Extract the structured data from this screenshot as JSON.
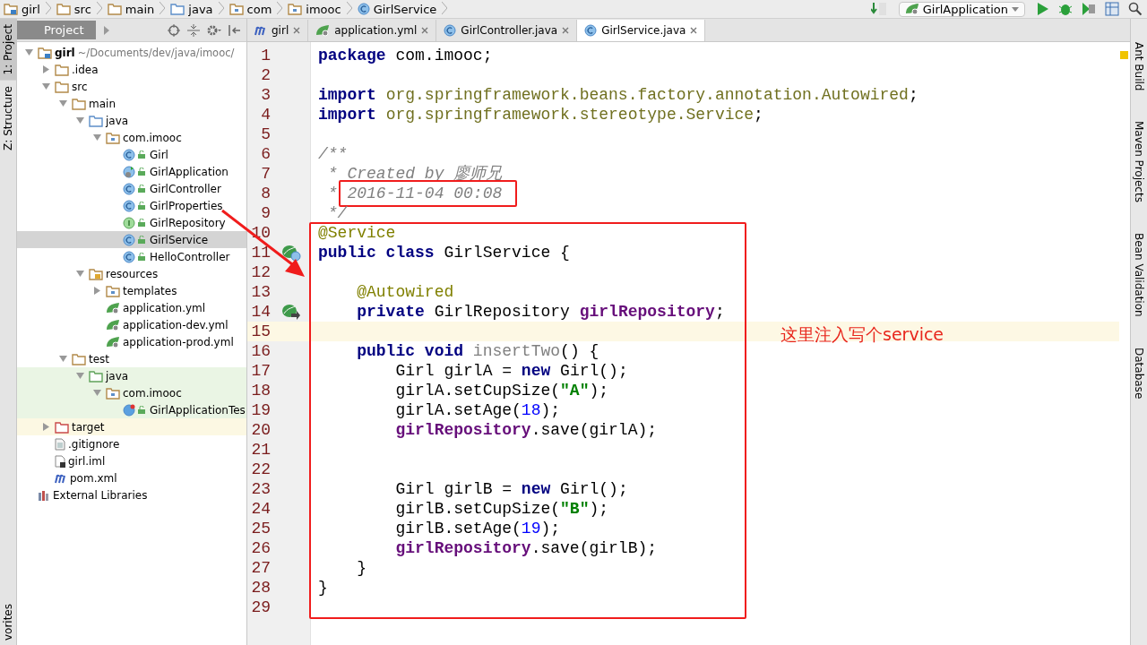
{
  "breadcrumbs": [
    {
      "label": "girl",
      "kind": "module"
    },
    {
      "label": "src",
      "kind": "folder"
    },
    {
      "label": "main",
      "kind": "folder"
    },
    {
      "label": "java",
      "kind": "source"
    },
    {
      "label": "com",
      "kind": "package"
    },
    {
      "label": "imooc",
      "kind": "package"
    },
    {
      "label": "GirlService",
      "kind": "class"
    }
  ],
  "run_config": {
    "label": "GirlApplication"
  },
  "side_tools_left": [
    {
      "label": "1: Project",
      "selected": true
    },
    {
      "label": "Z: Structure",
      "selected": false
    },
    {
      "label": "vorites",
      "selected": false
    }
  ],
  "side_tools_right": [
    {
      "label": "Ant Build"
    },
    {
      "label": "Maven Projects"
    },
    {
      "label": "Bean Validation"
    },
    {
      "label": "Database"
    }
  ],
  "project_panel": {
    "title": "Project"
  },
  "tabs": [
    {
      "label": "girl",
      "kind": "maven",
      "selected": false
    },
    {
      "label": "application.yml",
      "kind": "yml",
      "selected": false
    },
    {
      "label": "GirlController.java",
      "kind": "class",
      "selected": false
    },
    {
      "label": "GirlService.java",
      "kind": "class",
      "selected": true
    }
  ],
  "tree": [
    {
      "label": "girl",
      "kind": "module",
      "hint": "~/Documents/dev/java/imooc/",
      "expanded": true,
      "selected": false,
      "children": [
        {
          "label": ".idea",
          "kind": "folder",
          "expanded": false,
          "selected": false
        },
        {
          "label": "src",
          "kind": "folder",
          "expanded": true,
          "selected": false,
          "children": [
            {
              "label": "main",
              "kind": "folder",
              "expanded": true,
              "selected": false,
              "children": [
                {
                  "label": "java",
                  "kind": "source",
                  "expanded": true,
                  "selected": false,
                  "children": [
                    {
                      "label": "com.imooc",
                      "kind": "package",
                      "expanded": true,
                      "selected": false,
                      "children": [
                        {
                          "label": "Girl",
                          "kind": "class",
                          "selected": false
                        },
                        {
                          "label": "GirlApplication",
                          "kind": "spring-class",
                          "selected": false
                        },
                        {
                          "label": "GirlController",
                          "kind": "class",
                          "selected": false
                        },
                        {
                          "label": "GirlProperties",
                          "kind": "class",
                          "selected": false
                        },
                        {
                          "label": "GirlRepository",
                          "kind": "interface",
                          "selected": false
                        },
                        {
                          "label": "GirlService",
                          "kind": "class",
                          "selected": true
                        },
                        {
                          "label": "HelloController",
                          "kind": "class",
                          "selected": false
                        }
                      ]
                    }
                  ]
                },
                {
                  "label": "resources",
                  "kind": "resources",
                  "expanded": true,
                  "selected": false,
                  "children": [
                    {
                      "label": "templates",
                      "kind": "package",
                      "expanded": false,
                      "selected": false
                    },
                    {
                      "label": "application.yml",
                      "kind": "yml",
                      "selected": false
                    },
                    {
                      "label": "application-dev.yml",
                      "kind": "yml",
                      "selected": false
                    },
                    {
                      "label": "application-prod.yml",
                      "kind": "yml",
                      "selected": false
                    }
                  ]
                }
              ]
            },
            {
              "label": "test",
              "kind": "folder",
              "expanded": true,
              "selected": false,
              "children": [
                {
                  "label": "java",
                  "kind": "test-source",
                  "expanded": true,
                  "selected": false,
                  "test_scope": true,
                  "children": [
                    {
                      "label": "com.imooc",
                      "kind": "package",
                      "expanded": true,
                      "selected": false,
                      "test_scope": true,
                      "children": [
                        {
                          "label": "GirlApplicationTes",
                          "kind": "test-class",
                          "selected": false,
                          "test_scope": true
                        }
                      ]
                    }
                  ]
                }
              ]
            }
          ]
        },
        {
          "label": "target",
          "kind": "excluded",
          "expanded": false,
          "selected": false,
          "excluded": true
        },
        {
          "label": ".gitignore",
          "kind": "file",
          "selected": false
        },
        {
          "label": "girl.iml",
          "kind": "iml",
          "selected": false
        },
        {
          "label": "pom.xml",
          "kind": "maven",
          "selected": false
        }
      ]
    },
    {
      "label": "External Libraries",
      "kind": "libraries",
      "selected": false
    }
  ],
  "code_lines": [
    {
      "number": "1",
      "current": false,
      "tokens": [
        {
          "kind": "kw",
          "text": "package"
        },
        {
          "kind": "plain",
          "text": " com.imooc;"
        }
      ]
    },
    {
      "number": "2",
      "current": false
    },
    {
      "number": "3",
      "current": false,
      "tokens": [
        {
          "kind": "kw",
          "text": "import"
        },
        {
          "kind": "path",
          "text": " org.springframework.beans.factory.annotation.Autowired"
        },
        {
          "kind": "plain",
          "text": ";"
        }
      ]
    },
    {
      "number": "4",
      "current": false,
      "tokens": [
        {
          "kind": "kw",
          "text": "import"
        },
        {
          "kind": "path",
          "text": " org.springframework.stereotype.Service"
        },
        {
          "kind": "plain",
          "text": ";"
        }
      ]
    },
    {
      "number": "5",
      "current": false
    },
    {
      "number": "6",
      "current": false,
      "tokens": [
        {
          "kind": "cmt",
          "text": "/**"
        }
      ]
    },
    {
      "number": "7",
      "current": false,
      "tokens": [
        {
          "kind": "cmt",
          "text": " * Created by 廖师兄"
        }
      ]
    },
    {
      "number": "8",
      "current": false,
      "tokens": [
        {
          "kind": "cmt",
          "text": " *"
        },
        {
          "kind": "cmt",
          "text": " 2016-11-04 00:08",
          "boxed": true
        }
      ]
    },
    {
      "number": "9",
      "current": false,
      "tokens": [
        {
          "kind": "cmt",
          "text": " */"
        }
      ]
    },
    {
      "number": "10",
      "current": false,
      "tokens": [
        {
          "kind": "ann",
          "text": "@Service"
        }
      ]
    },
    {
      "number": "11",
      "current": false,
      "gutter": {
        "kind": "bean-class"
      },
      "tokens": [
        {
          "kind": "kw",
          "text": "public class"
        },
        {
          "kind": "plain",
          "text": " GirlService {"
        }
      ]
    },
    {
      "number": "12",
      "current": false
    },
    {
      "number": "13",
      "current": false,
      "tokens": [
        {
          "kind": "ann",
          "text": "    @Autowired"
        }
      ]
    },
    {
      "number": "14",
      "current": false,
      "gutter": {
        "kind": "bean-link"
      },
      "tokens": [
        {
          "kind": "kw",
          "text": "    private"
        },
        {
          "kind": "plain",
          "text": " GirlRepository "
        },
        {
          "kind": "fld",
          "text": "girlRepository"
        },
        {
          "kind": "plain",
          "text": ";"
        }
      ]
    },
    {
      "number": "15",
      "current": true
    },
    {
      "number": "16",
      "current": false,
      "tokens": [
        {
          "kind": "kw",
          "text": "    public void"
        },
        {
          "kind": "unused",
          "text": " insertTwo"
        },
        {
          "kind": "plain",
          "text": "() {"
        }
      ]
    },
    {
      "number": "17",
      "current": false,
      "tokens": [
        {
          "kind": "plain",
          "text": "        Girl girlA = "
        },
        {
          "kind": "kw",
          "text": "new"
        },
        {
          "kind": "plain",
          "text": " Girl();"
        }
      ]
    },
    {
      "number": "18",
      "current": false,
      "tokens": [
        {
          "kind": "plain",
          "text": "        girlA.setCupSize("
        },
        {
          "kind": "str",
          "text": "\"A\""
        },
        {
          "kind": "plain",
          "text": ");"
        }
      ]
    },
    {
      "number": "19",
      "current": false,
      "tokens": [
        {
          "kind": "plain",
          "text": "        girlA.setAge("
        },
        {
          "kind": "num",
          "text": "18"
        },
        {
          "kind": "plain",
          "text": ");"
        }
      ]
    },
    {
      "number": "20",
      "current": false,
      "tokens": [
        {
          "kind": "fld",
          "text": "        girlRepository"
        },
        {
          "kind": "plain",
          "text": ".save(girlA);"
        }
      ]
    },
    {
      "number": "21",
      "current": false
    },
    {
      "number": "22",
      "current": false
    },
    {
      "number": "23",
      "current": false,
      "tokens": [
        {
          "kind": "plain",
          "text": "        Girl girlB = "
        },
        {
          "kind": "kw",
          "text": "new"
        },
        {
          "kind": "plain",
          "text": " Girl();"
        }
      ]
    },
    {
      "number": "24",
      "current": false,
      "tokens": [
        {
          "kind": "plain",
          "text": "        girlB.setCupSize("
        },
        {
          "kind": "str",
          "text": "\"B\""
        },
        {
          "kind": "plain",
          "text": ");"
        }
      ]
    },
    {
      "number": "25",
      "current": false,
      "tokens": [
        {
          "kind": "plain",
          "text": "        girlB.setAge("
        },
        {
          "kind": "num",
          "text": "19"
        },
        {
          "kind": "plain",
          "text": ");"
        }
      ]
    },
    {
      "number": "26",
      "current": false,
      "tokens": [
        {
          "kind": "fld",
          "text": "        girlRepository"
        },
        {
          "kind": "plain",
          "text": ".save(girlB);"
        }
      ]
    },
    {
      "number": "27",
      "current": false,
      "tokens": [
        {
          "kind": "plain",
          "text": "    }"
        }
      ]
    },
    {
      "number": "28",
      "current": false,
      "tokens": [
        {
          "kind": "plain",
          "text": "}"
        }
      ]
    },
    {
      "number": "29",
      "current": false
    }
  ],
  "annotation_note": "这里注入写个service"
}
